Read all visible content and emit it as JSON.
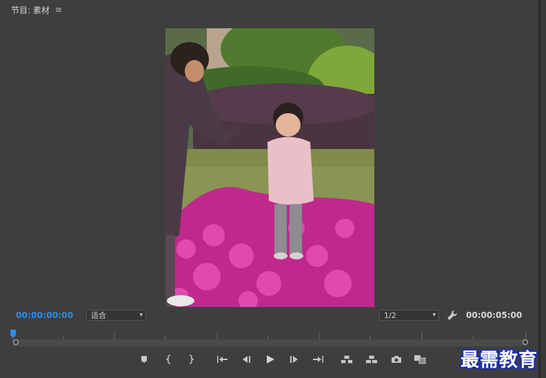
{
  "panel": {
    "title": "节目: 素材",
    "menu_icon": "hamburger-menu-icon"
  },
  "timecode": {
    "current": "00:00:00:00",
    "duration": "00:00:05:00",
    "current_color": "#2d8ceb"
  },
  "zoom_select": {
    "value": "适合"
  },
  "resolution_select": {
    "value": "1/2"
  },
  "settings": {
    "icon": "wrench-icon"
  },
  "transport": [
    {
      "name": "add-marker-button",
      "icon": "marker-icon"
    },
    {
      "name": "mark-in-button",
      "icon": "mark-in-icon"
    },
    {
      "name": "mark-out-button",
      "icon": "mark-out-icon"
    },
    {
      "name": "go-to-in-button",
      "icon": "go-to-in-icon"
    },
    {
      "name": "step-back-button",
      "icon": "step-back-icon"
    },
    {
      "name": "play-button",
      "icon": "play-icon"
    },
    {
      "name": "step-forward-button",
      "icon": "step-forward-icon"
    },
    {
      "name": "go-to-out-button",
      "icon": "go-to-out-icon"
    },
    {
      "name": "lift-button",
      "icon": "lift-icon"
    },
    {
      "name": "extract-button",
      "icon": "extract-icon"
    },
    {
      "name": "export-frame-button",
      "icon": "camera-icon"
    },
    {
      "name": "comparison-view-button",
      "icon": "comparison-view-icon"
    }
  ],
  "watermark": {
    "text": "最需教育"
  }
}
